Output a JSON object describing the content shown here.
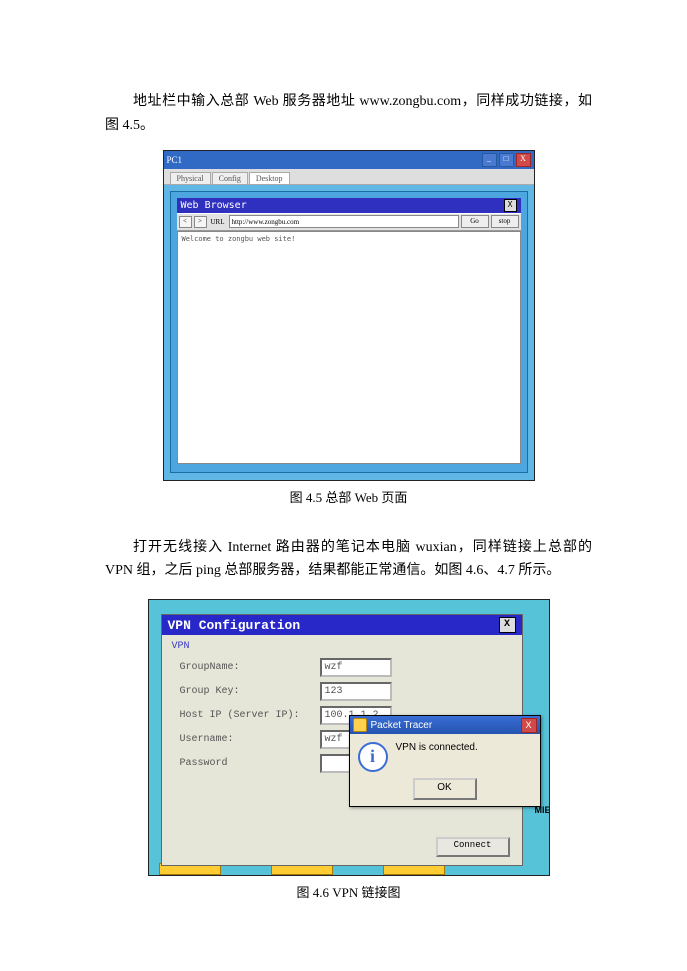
{
  "para1": "地址栏中输入总部 Web 服务器地址 www.zongbu.com，同样成功链接，如图 4.5。",
  "caption45": "图 4.5  总部 Web 页面",
  "para2": "打开无线接入 Internet 路由器的笔记本电脑 wuxian，同样链接上总部的 VPN 组，之后 ping 总部服务器，结果都能正常通信。如图 4.6、4.7 所示。",
  "caption46": "图 4.6 VPN 链接图",
  "fig45": {
    "windowTitle": "PC1",
    "tabs": {
      "t1": "Physical",
      "t2": "Config",
      "t3": "Desktop"
    },
    "browserTitle": "Web Browser",
    "urlLabel": "URL",
    "url": "http://www.zongbu.com",
    "go": "Go",
    "stop": "stop",
    "back": "<",
    "fwd": ">",
    "pageText": "Welcome to zongbu web site!",
    "xBtn": "X"
  },
  "fig46": {
    "vpnTitle": "VPN Configuration",
    "section": "VPN",
    "fields": {
      "gn_lbl": "GroupName:",
      "gn_val": "wzf",
      "gk_lbl": "Group Key:",
      "gk_val": "123",
      "hi_lbl": "Host IP (Server IP):",
      "hi_val": "100.1.1.2",
      "un_lbl": "Username:",
      "un_val": "wzf",
      "pw_lbl": "Password",
      "pw_val": ""
    },
    "connect": "Connect",
    "close": "X",
    "dlg": {
      "title": "Packet Tracer",
      "msg": "VPN is connected.",
      "ok": "OK",
      "x": "X"
    },
    "mie": "MIE"
  }
}
